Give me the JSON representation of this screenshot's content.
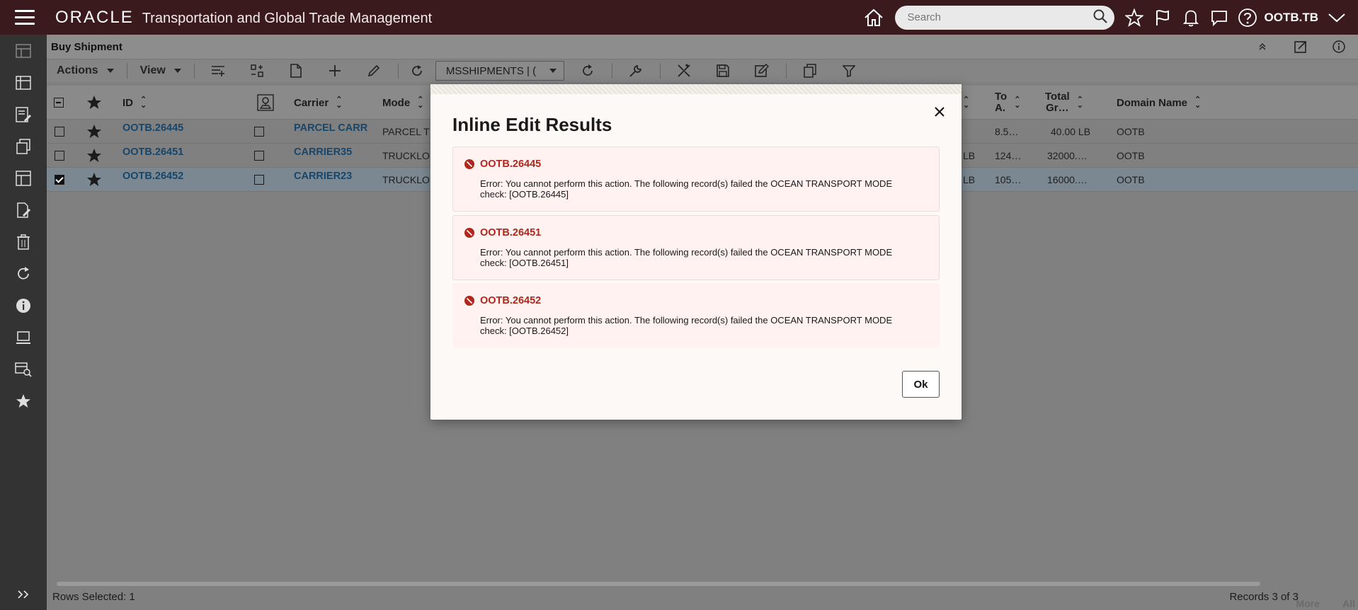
{
  "app": {
    "brand": "ORACLE",
    "title": "Transportation and Global Trade Management",
    "search_placeholder": "Search",
    "user": "OOTB.TB"
  },
  "page": {
    "title": "Buy Shipment"
  },
  "toolbar": {
    "actions_label": "Actions",
    "view_label": "View",
    "saved_query": "MSSHIPMENTS | (",
    "icons": [
      "add-row-icon",
      "layout-icon",
      "new-doc-icon",
      "plus-icon",
      "pencil-icon",
      "refresh-icon",
      "reload-icon",
      "wrench-icon",
      "tools-icon",
      "save-icon",
      "edit-note-icon",
      "copy-icon",
      "filter-icon"
    ]
  },
  "grid": {
    "headers": {
      "id": "ID",
      "carrier": "Carrier",
      "mode": "Mode",
      "to_a": "To\nA.",
      "total_gr": "Total\nGr…",
      "domain": "Domain Name"
    },
    "rows": [
      {
        "id": "OOTB.26445",
        "carrier": "PARCEL CARR",
        "mode": "PARCEL T",
        "unit_frag": "",
        "to_a": "8.5…",
        "total_gr": "40.00 LB",
        "domain": "OOTB",
        "checked": false
      },
      {
        "id": "OOTB.26451",
        "carrier": "CARRIER35",
        "mode": "TRUCKLO",
        "unit_frag": "LB",
        "to_a": "124…",
        "total_gr": "32000.…",
        "domain": "OOTB",
        "checked": false
      },
      {
        "id": "OOTB.26452",
        "carrier": "CARRIER23",
        "mode": "TRUCKLO",
        "unit_frag": "LB",
        "to_a": "105…",
        "total_gr": "16000.…",
        "domain": "OOTB",
        "checked": true
      }
    ]
  },
  "footer": {
    "rows_selected": "Rows Selected: 1",
    "records": "Records 3 of 3",
    "more": "More",
    "all": "All"
  },
  "dialog": {
    "title": "Inline Edit Results",
    "messages": [
      {
        "id": "OOTB.26445",
        "text": "Error: You cannot perform this action. The following record(s) failed the OCEAN TRANSPORT MODE check: [OOTB.26445]"
      },
      {
        "id": "OOTB.26451",
        "text": "Error: You cannot perform this action. The following record(s) failed the OCEAN TRANSPORT MODE check: [OOTB.26451]"
      },
      {
        "id": "OOTB.26452",
        "text": "Error: You cannot perform this action. The following record(s) failed the OCEAN TRANSPORT MODE check: [OOTB.26452]"
      }
    ],
    "ok_label": "Ok"
  },
  "colors": {
    "topbar": "#3b1a1e",
    "leftnav": "#333333",
    "error_text": "#b0271b",
    "link": "#17466a"
  }
}
